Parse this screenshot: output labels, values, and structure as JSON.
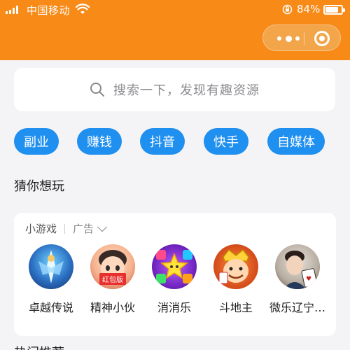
{
  "status_bar": {
    "carrier": "中国移动",
    "battery_text": "84%",
    "battery_level": 0.84,
    "signal_icon": "signal-icon",
    "wifi_icon": "wifi-icon",
    "lock_icon": "rotation-lock-icon"
  },
  "capsule": {
    "more_icon": "more-dots-icon",
    "close_icon": "close-miniprogram-icon"
  },
  "search": {
    "placeholder": "搜索一下，发现有趣资源",
    "icon": "search-icon"
  },
  "chips": [
    "副业",
    "赚钱",
    "抖音",
    "快手",
    "自媒体"
  ],
  "section_title": "猜你想玩",
  "card": {
    "label": "小游戏",
    "ad_label": "广告",
    "games": [
      {
        "name": "卓越传说",
        "badge": ""
      },
      {
        "name": "精神小伙",
        "badge": "红包版"
      },
      {
        "name": "消消乐",
        "badge": ""
      },
      {
        "name": "斗地主",
        "badge": ""
      },
      {
        "name": "微乐辽宁…",
        "badge": ""
      }
    ]
  },
  "next_section_title": "热门推荐",
  "colors": {
    "header_orange": "#f88a17",
    "chip_blue": "#1f8ff0",
    "badge_red": "#e7302d"
  }
}
